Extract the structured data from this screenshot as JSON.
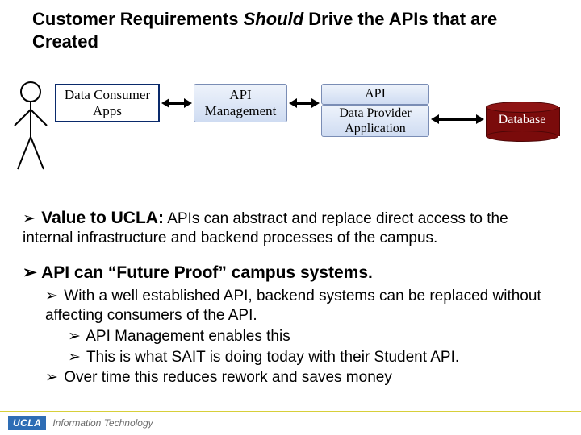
{
  "title": {
    "pre": "Customer Requirements ",
    "should": "Should",
    "post": " Drive the APIs that are Created"
  },
  "diagram": {
    "consumer": "Data Consumer\nApps",
    "apimgmt": "API\nManagement",
    "api": "API",
    "provider": "Data Provider\nApplication",
    "database": "Database"
  },
  "bullets": {
    "value_lead": "Value to UCLA:",
    "value_rest": " APIs can abstract and replace direct access to the internal infrastructure and backend processes of the campus.",
    "future": "API can “Future Proof” campus systems.",
    "sub1": "With a well established API, backend systems can be replaced without affecting consumers of the API.",
    "sub2a": "API Management enables this",
    "sub2b": "This is what SAIT is doing today with their Student API.",
    "sub3": "Over time this reduces rework and saves money"
  },
  "footer": {
    "logo": "UCLA",
    "text": "Information Technology"
  },
  "glyph": {
    "chevron": "➢"
  }
}
